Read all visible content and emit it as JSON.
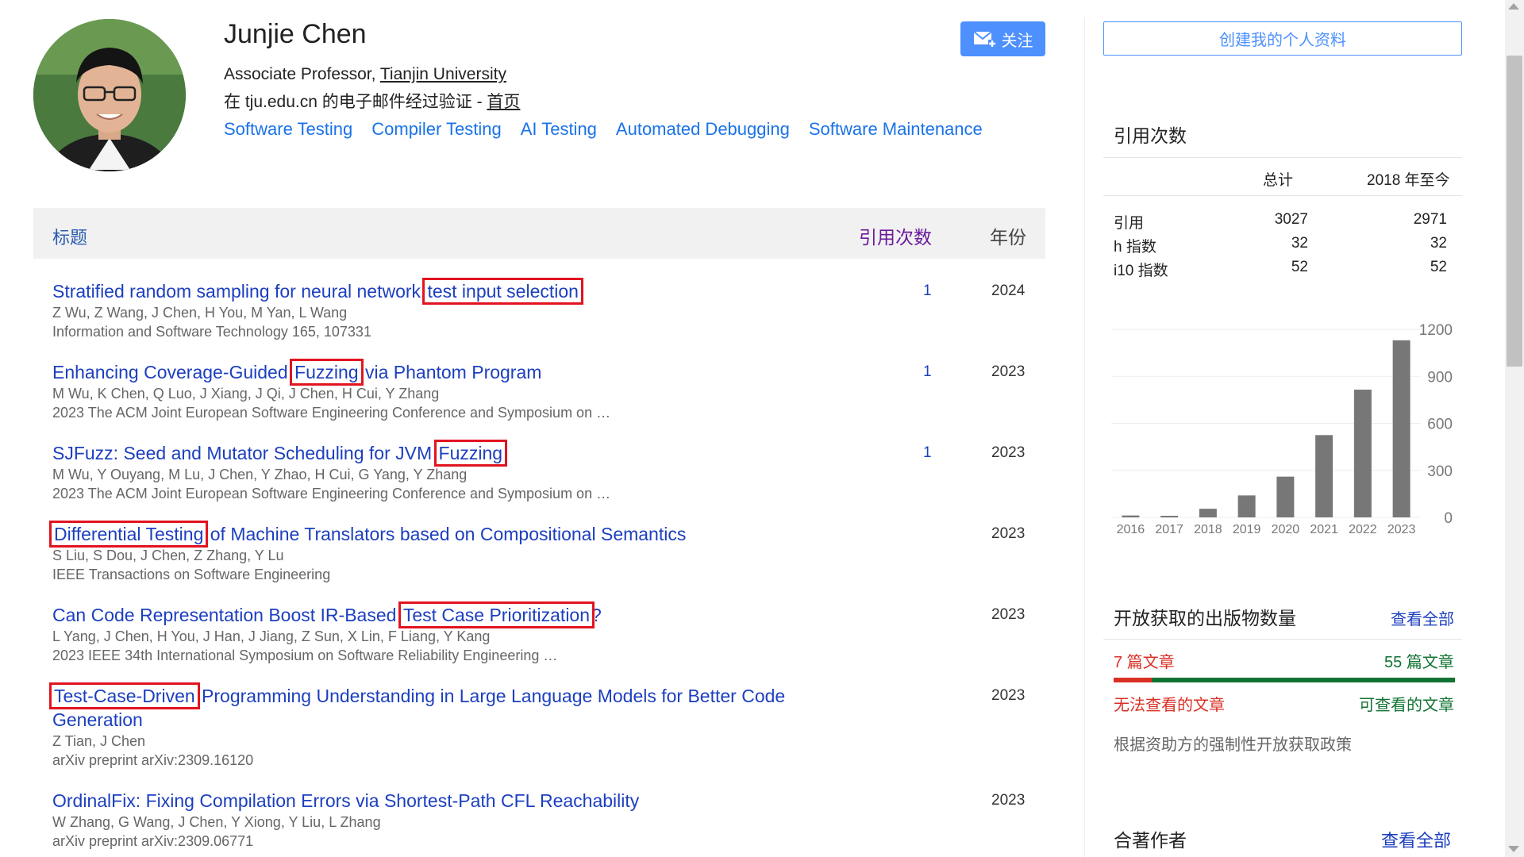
{
  "profile": {
    "name": "Junjie Chen",
    "position": "Associate Professor, ",
    "university": "Tianjin University",
    "verified_prefix": "在 tju.edu.cn 的电子邮件经过验证 - ",
    "homepage": "首页",
    "interests": [
      "Software Testing",
      "Compiler Testing",
      "AI Testing",
      "Automated Debugging",
      "Software Maintenance"
    ],
    "follow_label": "关注"
  },
  "table": {
    "col_title": "标题",
    "col_cites": "引用次数",
    "col_year": "年份",
    "rows": [
      {
        "title_parts": [
          "Stratified random sampling for neural network ",
          "test input selection",
          ""
        ],
        "authors": "Z Wu, Z Wang, J Chen, H You, M Yan, L Wang",
        "venue": "Information and Software Technology 165, 107331",
        "cites": "1",
        "year": "2024"
      },
      {
        "title_parts": [
          "Enhancing Coverage-Guided ",
          "Fuzzing",
          " via Phantom Program"
        ],
        "authors": "M Wu, K Chen, Q Luo, J Xiang, J Qi, J Chen, H Cui, Y Zhang",
        "venue": "2023 The ACM Joint European Software Engineering Conference and Symposium on …",
        "cites": "1",
        "year": "2023"
      },
      {
        "title_parts": [
          "SJFuzz: Seed and Mutator Scheduling for JVM ",
          "Fuzzing",
          ""
        ],
        "authors": "M Wu, Y Ouyang, M Lu, J Chen, Y Zhao, H Cui, G Yang, Y Zhang",
        "venue": "2023 The ACM Joint European Software Engineering Conference and Symposium on …",
        "cites": "1",
        "year": "2023"
      },
      {
        "title_parts": [
          "",
          "Differential Testing",
          " of Machine Translators based on Compositional Semantics"
        ],
        "authors": "S Liu, S Dou, J Chen, Z Zhang, Y Lu",
        "venue": "IEEE Transactions on Software Engineering",
        "cites": "",
        "year": "2023"
      },
      {
        "title_parts": [
          "Can Code Representation Boost IR-Based ",
          "Test Case Prioritization",
          "?"
        ],
        "authors": "L Yang, J Chen, H You, J Han, J Jiang, Z Sun, X Lin, F Liang, Y Kang",
        "venue": "2023 IEEE 34th International Symposium on Software Reliability Engineering …",
        "cites": "",
        "year": "2023"
      },
      {
        "title_parts": [
          "",
          "Test-Case-Driven",
          " Programming Understanding in Large Language Models for Better Code Generation"
        ],
        "authors": "Z Tian, J Chen",
        "venue": "arXiv preprint arXiv:2309.16120",
        "cites": "",
        "year": "2023"
      },
      {
        "title_parts": [
          "OrdinalFix: Fixing Compilation Errors via Shortest-Path CFL Reachability",
          "",
          ""
        ],
        "authors": "W Zhang, G Wang, J Chen, Y Xiong, Y Liu, L Zhang",
        "venue": "arXiv preprint arXiv:2309.06771",
        "cites": "",
        "year": "2023"
      }
    ]
  },
  "sidebar": {
    "create_profile": "创建我的个人资料",
    "cited_by_title": "引用次数",
    "col_all": "总计",
    "col_since": "2018 年至今",
    "metrics": [
      {
        "label": "引用",
        "all": "3027",
        "since": "2971"
      },
      {
        "label": "h 指数",
        "all": "32",
        "since": "32"
      },
      {
        "label": "i10 指数",
        "all": "52",
        "since": "52"
      }
    ],
    "open_access_title": "开放获取的出版物数量",
    "view_all": "查看全部",
    "oa_unavailable_count": "7 篇文章",
    "oa_available_count": "55 篇文章",
    "oa_unavailable_label": "无法查看的文章",
    "oa_available_label": "可查看的文章",
    "oa_note": "根据资助方的强制性开放获取政策",
    "coauthors_title": "合著作者",
    "coauthors_view_all": "查看全部"
  },
  "chart_data": {
    "type": "bar",
    "categories": [
      "2016",
      "2017",
      "2018",
      "2019",
      "2020",
      "2021",
      "2022",
      "2023"
    ],
    "values": [
      12,
      10,
      55,
      140,
      260,
      525,
      815,
      1130
    ],
    "ylim": [
      0,
      1200
    ],
    "yticks": [
      0,
      300,
      600,
      900,
      1200
    ],
    "bar_color": "#777777"
  },
  "colors": {
    "link": "#1c3fbf",
    "accent": "#4d90fe",
    "highlight_box": "#e1141f"
  }
}
